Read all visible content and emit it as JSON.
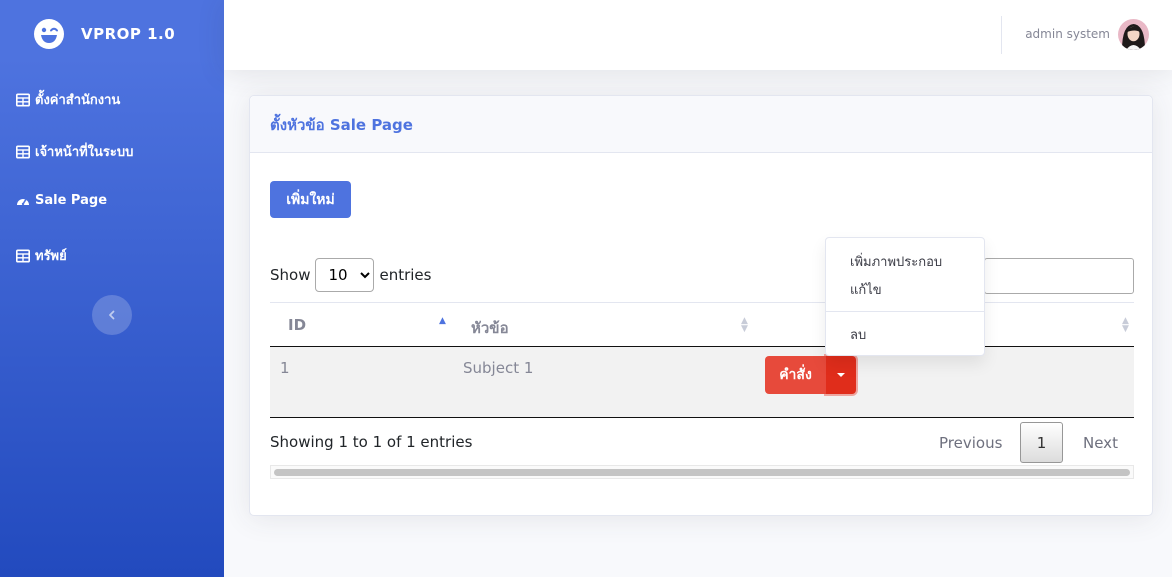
{
  "brand": {
    "name": "VPROP 1.0",
    "logo_icon": "laugh-wink-icon"
  },
  "sidebar": {
    "items": [
      {
        "label": "ตั้งค่าสำนักงาน",
        "icon": "table-icon"
      },
      {
        "label": "เจ้าหน้าที่ในระบบ",
        "icon": "table-icon"
      },
      {
        "label": "Sale Page",
        "icon": "tachometer-icon"
      },
      {
        "label": "ทรัพย์",
        "icon": "table-icon"
      }
    ],
    "toggle_icon": "chevron-left-icon"
  },
  "topbar": {
    "user_name": "admin system"
  },
  "card": {
    "title": "ตั้งหัวข้อ Sale Page",
    "add_button": "เพิ่มใหม่"
  },
  "table_controls": {
    "show_label": "Show",
    "entries_label": "entries",
    "page_length": "10",
    "page_length_options": [
      "10"
    ]
  },
  "table": {
    "columns": [
      "ID",
      "หัวข้อ",
      ""
    ],
    "rows": [
      {
        "id": "1",
        "subject": "Subject 1",
        "action_label": "คำสั่ง"
      }
    ]
  },
  "footer": {
    "info": "Showing 1 to 1 of 1 entries",
    "previous": "Previous",
    "current_page": "1",
    "next": "Next"
  },
  "dropdown_menu": {
    "items": [
      "เพิ่มภาพประกอบ",
      "แก้ไข",
      "ลบ"
    ]
  },
  "colors": {
    "primary": "#4e73df",
    "danger": "#e74a3b",
    "sidebar_gradient_top": "#4e73df",
    "sidebar_gradient_bottom": "#224abe"
  }
}
